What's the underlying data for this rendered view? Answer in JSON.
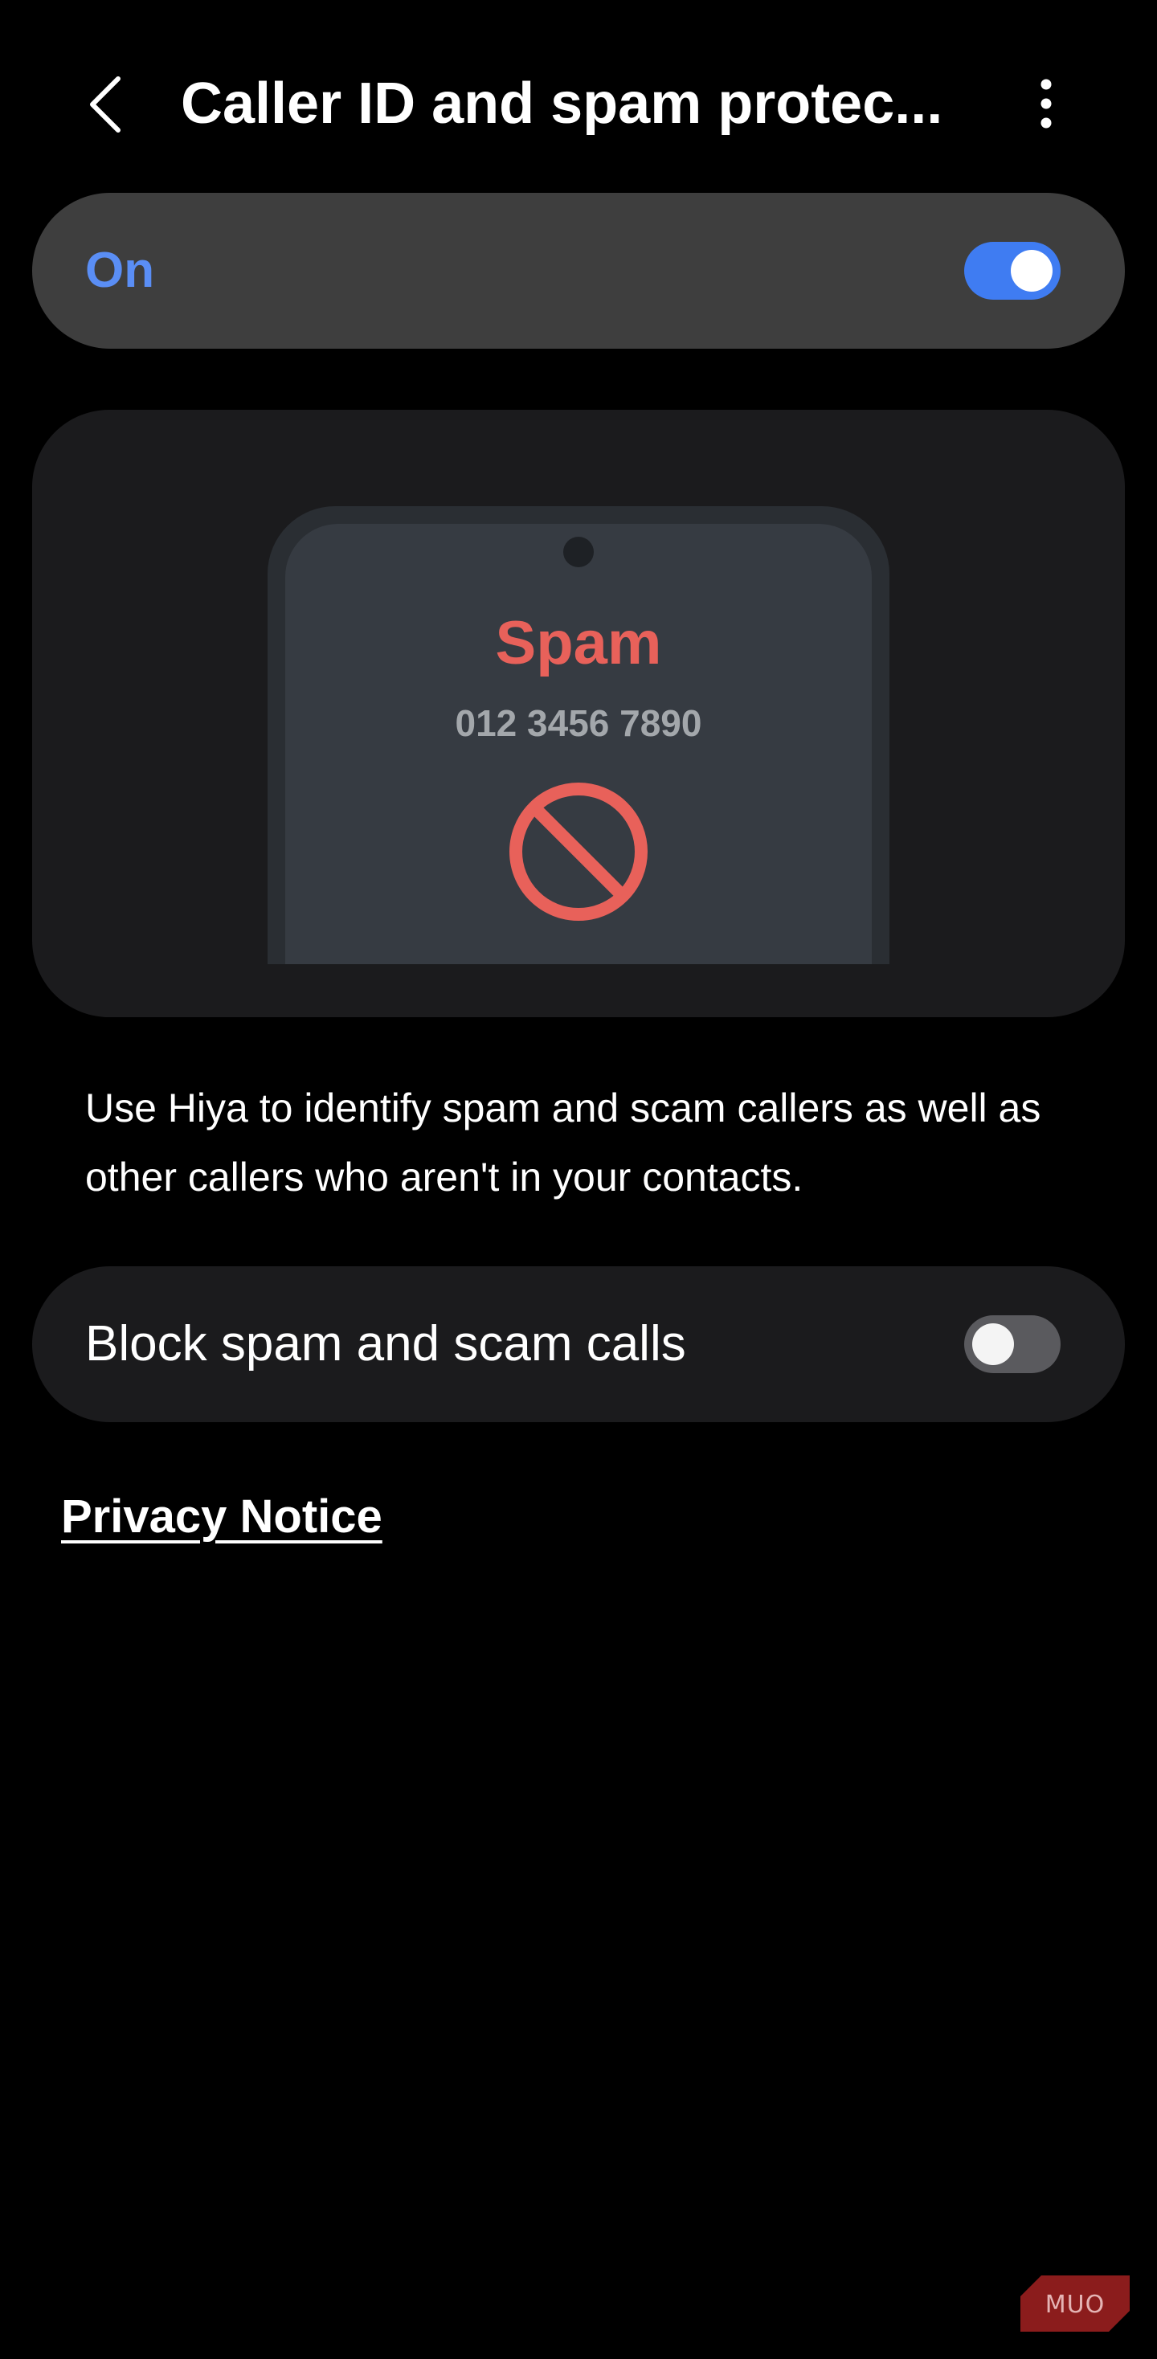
{
  "header": {
    "title": "Caller ID and spam protec...",
    "back_icon": "back-arrow-icon",
    "more_icon": "more-vertical-icon"
  },
  "master_switch": {
    "label": "On",
    "enabled": true
  },
  "illustration": {
    "spam_label": "Spam",
    "phone_number": "012 3456 7890",
    "icon": "block-icon"
  },
  "description": "Use Hiya to identify spam and scam callers as well as other callers who aren't in your contacts.",
  "block_setting": {
    "label": "Block spam and scam calls",
    "enabled": false
  },
  "privacy_link": "Privacy Notice",
  "watermark": {
    "text": "MUO"
  },
  "colors": {
    "accent": "#4a7df5",
    "spam_red": "#e8615a",
    "toggle_off_track": "#5a5a5e",
    "card_dark": "#1b1b1d",
    "card_master": "#3e3e3e"
  }
}
